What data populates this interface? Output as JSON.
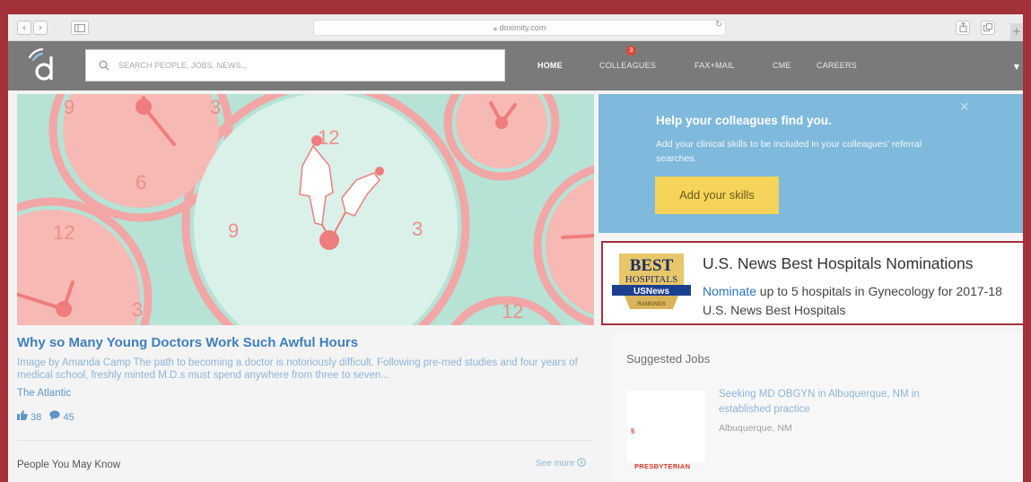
{
  "browser": {
    "url": "doximity.com",
    "back_icon": "chevron-left-icon",
    "forward_icon": "chevron-right-icon"
  },
  "header": {
    "search_placeholder": "SEARCH PEOPLE, JOBS, NEWS...",
    "nav": {
      "home": "HOME",
      "colleagues": "COLLEAGUES",
      "colleagues_badge": "3",
      "fax_mail": "FAX+MAIL",
      "cme": "CME",
      "careers": "CAREERS"
    },
    "brand_color": "#7a7a7a"
  },
  "hero": {
    "article_title": "Why so Many Young Doctors Work Such Awful Hours",
    "excerpt": "Image by Amanda Camp The path to becoming a doctor is notoriously difficult. Following pre-med studies and four years of medical school, freshly minted M.D.s must spend anywhere from three to seven...",
    "source": "The Atlantic",
    "likes": "38",
    "comments": "45",
    "clock_numbers": [
      "9",
      "3",
      "6",
      "12",
      "9",
      "3",
      "12",
      "3",
      "12"
    ]
  },
  "pymk": {
    "title": "People You May Know",
    "see_more": "See more"
  },
  "skills_card": {
    "title": "Help your colleagues find you.",
    "body": "Add your clinical skills to be included in your colleagues' referral searches.",
    "button": "Add your skills",
    "accent": "#7fb9dc"
  },
  "usnews": {
    "title": "U.S. News Best Hospitals Nominations",
    "link": "Nominate",
    "body": " up to 5 hospitals in Gynecology for 2017-18 U.S. News Best Hospitals",
    "emblem": {
      "best": "BEST",
      "hospitals": "HOSPITALS",
      "usnews": "USNews",
      "rankings": "RANKINGS"
    }
  },
  "jobs": {
    "title": "Suggested Jobs",
    "job_title": "Seeking MD OBGYN in Albuquerque, NM in established practice",
    "location": "Albuquerque, NM",
    "company": "PRESBYTERIAN"
  }
}
